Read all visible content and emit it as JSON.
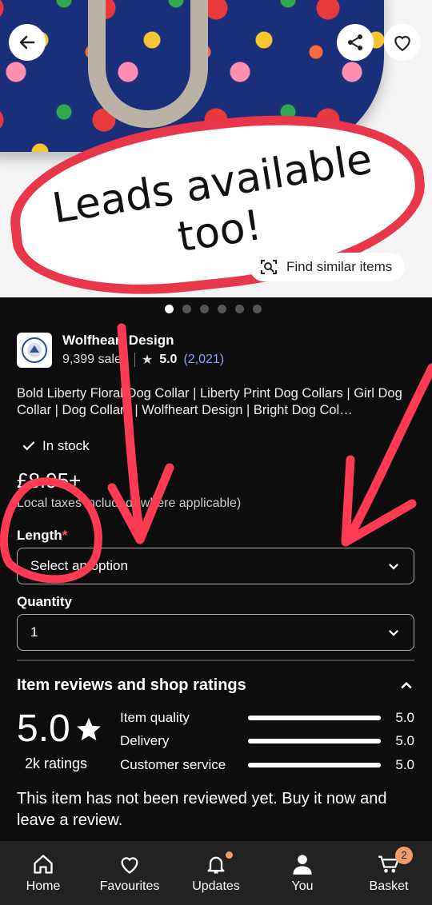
{
  "hero": {
    "promo_text": "Leads available too!",
    "find_similar_label": "Find similar items",
    "image_count": 6,
    "active_image": 1
  },
  "shop": {
    "name": "Wolfheart Design",
    "sales": "9,399 sales",
    "rating": "5.0",
    "review_count": "(2,021)"
  },
  "listing": {
    "title": "Bold Liberty Floral Dog Collar | Liberty Print Dog Collars | Girl Dog Collar | Dog Collars | Wolfheart Design | Bright Dog Col…",
    "stock_label": "In stock",
    "price": "£8.95+",
    "vat_note": "Local taxes included (where applicable)"
  },
  "options": {
    "length_label": "Length",
    "length_required_mark": "*",
    "length_value": "Select an option",
    "quantity_label": "Quantity",
    "quantity_value": "1"
  },
  "reviews": {
    "title": "Item reviews and shop ratings",
    "overall": "5.0",
    "ratings_count": "2k ratings",
    "rows": [
      {
        "label": "Item quality",
        "value": "5.0",
        "fill": 1.0
      },
      {
        "label": "Delivery",
        "value": "5.0",
        "fill": 1.0
      },
      {
        "label": "Customer service",
        "value": "5.0",
        "fill": 1.0
      }
    ],
    "empty_message": "This item has not been reviewed yet. Buy it now and leave a review."
  },
  "nav": {
    "items": [
      {
        "label": "Home",
        "icon": "home-icon"
      },
      {
        "label": "Favourites",
        "icon": "heart-icon"
      },
      {
        "label": "Updates",
        "icon": "bell-icon"
      },
      {
        "label": "You",
        "icon": "person-icon"
      },
      {
        "label": "Basket",
        "icon": "basket-icon"
      }
    ],
    "basket_count": "2"
  },
  "colors": {
    "accent_red": "#e8364a",
    "link_blue": "#8f9cff",
    "badge_orange": "#f19a6b"
  }
}
